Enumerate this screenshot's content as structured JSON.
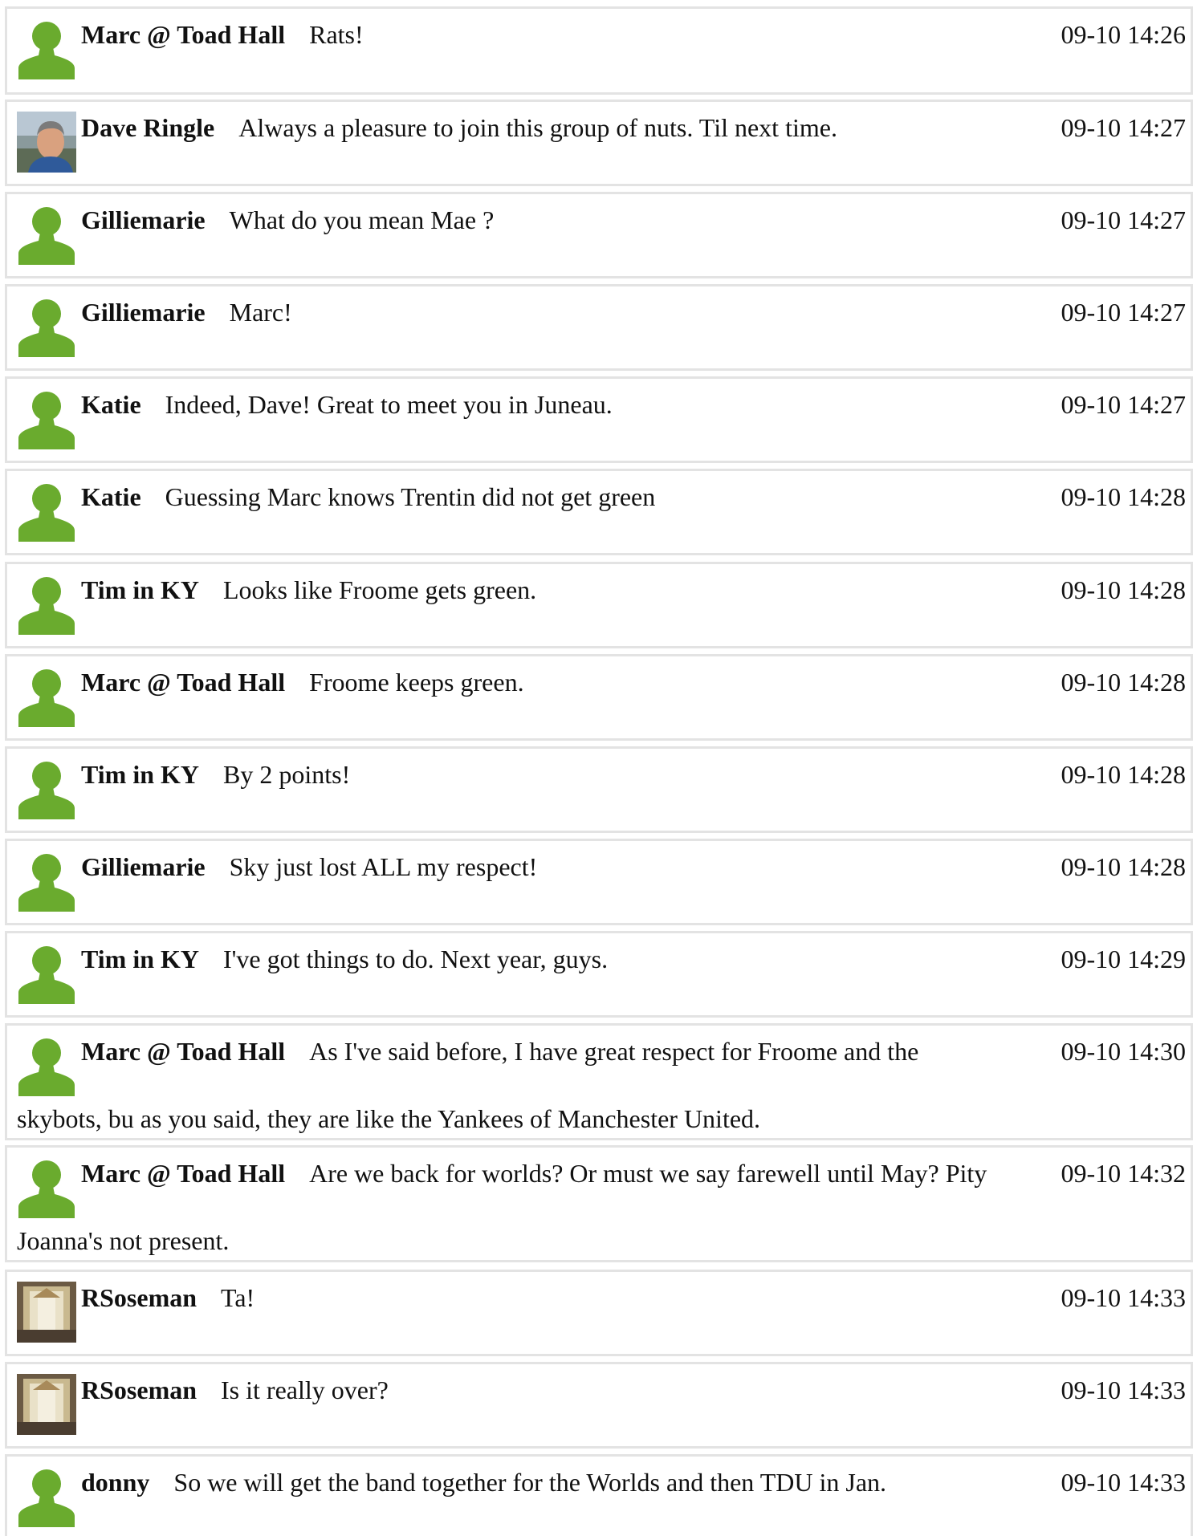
{
  "colors": {
    "default_avatar": "#6aab2e",
    "row_border": "#e3e3e3"
  },
  "messages": [
    {
      "user": "Marc @ Toad Hall",
      "text": "Rats!",
      "time": "09-10 14:26",
      "avatar": "default-user-icon"
    },
    {
      "user": "Dave Ringle",
      "text": "Always a pleasure to join this group of nuts. Til next time.",
      "time": "09-10 14:27",
      "avatar": "photo-avatar"
    },
    {
      "user": "Gilliemarie",
      "text": "What do you mean Mae ?",
      "time": "09-10 14:27",
      "avatar": "default-user-icon"
    },
    {
      "user": "Gilliemarie",
      "text": "Marc!",
      "time": "09-10 14:27",
      "avatar": "default-user-icon"
    },
    {
      "user": "Katie",
      "text": "Indeed, Dave! Great to meet you in Juneau.",
      "time": "09-10 14:27",
      "avatar": "default-user-icon"
    },
    {
      "user": "Katie",
      "text": "Guessing Marc knows Trentin did not get green",
      "time": "09-10 14:28",
      "avatar": "default-user-icon"
    },
    {
      "user": "Tim in KY",
      "text": "Looks like Froome gets green.",
      "time": "09-10 14:28",
      "avatar": "default-user-icon"
    },
    {
      "user": "Marc @ Toad Hall",
      "text": "Froome keeps green.",
      "time": "09-10 14:28",
      "avatar": "default-user-icon"
    },
    {
      "user": "Tim in KY",
      "text": "By 2 points!",
      "time": "09-10 14:28",
      "avatar": "default-user-icon"
    },
    {
      "user": "Gilliemarie",
      "text": "Sky just lost ALL my respect!",
      "time": "09-10 14:28",
      "avatar": "default-user-icon"
    },
    {
      "user": "Tim in KY",
      "text": "I've got things to do. Next year, guys.",
      "time": "09-10 14:29",
      "avatar": "default-user-icon"
    },
    {
      "user": "Marc @ Toad Hall",
      "text": "As I've said before, I have great respect for Froome and the",
      "text_cont": "skybots, bu as you said, they are like the Yankees of Manchester United.",
      "time": "09-10 14:30",
      "avatar": "default-user-icon"
    },
    {
      "user": "Marc @ Toad Hall",
      "text": "Are we back for worlds? Or must we say farewell until May? Pity",
      "text_cont": "Joanna's not present.",
      "time": "09-10 14:32",
      "avatar": "default-user-icon"
    },
    {
      "user": "RSoseman",
      "text": "Ta!",
      "time": "09-10 14:33",
      "avatar": "photo-avatar"
    },
    {
      "user": "RSoseman",
      "text": "Is it really over?",
      "time": "09-10 14:33",
      "avatar": "photo-avatar"
    },
    {
      "user": "donny",
      "text": "So we will get the band together for the Worlds and then TDU in Jan.",
      "time": "09-10 14:33",
      "avatar": "default-user-icon"
    }
  ]
}
